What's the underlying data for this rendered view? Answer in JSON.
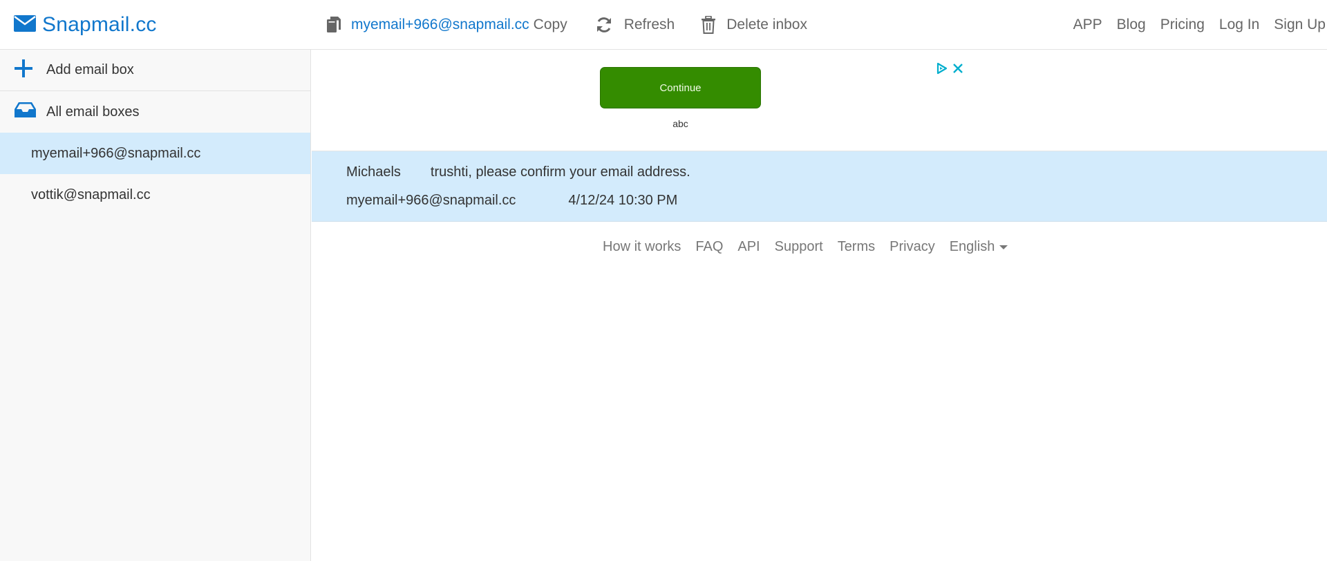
{
  "header": {
    "logo_text": "Snapmail.cc",
    "logo_icon": "envelope-icon",
    "current_email": "myemail+966@snapmail.cc",
    "copy_label": "Copy",
    "refresh_label": "Refresh",
    "delete_label": "Delete inbox",
    "nav": {
      "app": "APP",
      "blog": "Blog",
      "pricing": "Pricing",
      "login": "Log In",
      "signup": "Sign Up"
    }
  },
  "sidebar": {
    "add_label": "Add email box",
    "all_label": "All email boxes",
    "boxes": [
      {
        "address": "myemail+966@snapmail.cc",
        "active": true
      },
      {
        "address": "vottik@snapmail.cc",
        "active": false
      }
    ]
  },
  "ad": {
    "button_label": "Continue",
    "sub_label": "abc"
  },
  "emails": [
    {
      "sender": "Michaels",
      "subject": "trushti, please confirm your email address.",
      "recipient": "myemail+966@snapmail.cc",
      "date": "4/12/24 10:30 PM"
    }
  ],
  "footer": {
    "how": "How it works",
    "faq": "FAQ",
    "api": "API",
    "support": "Support",
    "terms": "Terms",
    "privacy": "Privacy",
    "language": "English"
  },
  "colors": {
    "brand": "#1177cc",
    "selected_bg": "#d3ebfc",
    "ad_button": "#348c00",
    "ad_icon": "#00aecd"
  }
}
